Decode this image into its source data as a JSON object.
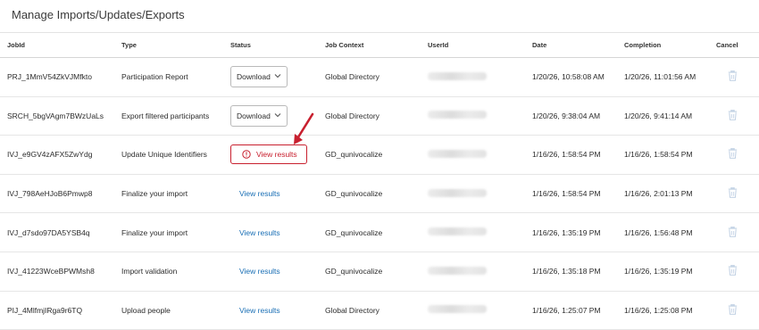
{
  "page": {
    "title": "Manage Imports/Updates/Exports"
  },
  "columns": {
    "jobid": "JobId",
    "type": "Type",
    "status": "Status",
    "context": "Job Context",
    "userid": "UserId",
    "date": "Date",
    "completion": "Completion",
    "cancel": "Cancel"
  },
  "colors": {
    "highlight": "#c8202f",
    "link": "#1a6fb5"
  },
  "rows": [
    {
      "jobid": "PRJ_1MmV54ZkVJMfkto",
      "type": "Participation Report",
      "status": "Download",
      "status_kind": "download",
      "context": "Global Directory",
      "date": "1/20/26, 10:58:08 AM",
      "completion": "1/20/26, 11:01:56 AM"
    },
    {
      "jobid": "SRCH_5bgVAgm7BWzUaLs",
      "type": "Export filtered participants",
      "status": "Download",
      "status_kind": "download",
      "context": "Global Directory",
      "date": "1/20/26, 9:38:04 AM",
      "completion": "1/20/26, 9:41:14 AM"
    },
    {
      "jobid": "IVJ_e9GV4zAFX5ZwYdg",
      "type": "Update Unique Identifiers",
      "status": "View results",
      "status_kind": "highlighted",
      "context": "GD_qunivocalize",
      "date": "1/16/26, 1:58:54 PM",
      "completion": "1/16/26, 1:58:54 PM"
    },
    {
      "jobid": "IVJ_798AeHJoB6Pmwp8",
      "type": "Finalize your import",
      "status": "View results",
      "status_kind": "link",
      "context": "GD_qunivocalize",
      "date": "1/16/26, 1:58:54 PM",
      "completion": "1/16/26, 2:01:13 PM"
    },
    {
      "jobid": "IVJ_d7sdo97DA5YSB4q",
      "type": "Finalize your import",
      "status": "View results",
      "status_kind": "link",
      "context": "GD_qunivocalize",
      "date": "1/16/26, 1:35:19 PM",
      "completion": "1/16/26, 1:56:48 PM"
    },
    {
      "jobid": "IVJ_41223WceBPWMsh8",
      "type": "Import validation",
      "status": "View results",
      "status_kind": "link",
      "context": "GD_qunivocalize",
      "date": "1/16/26, 1:35:18 PM",
      "completion": "1/16/26, 1:35:19 PM"
    },
    {
      "jobid": "PIJ_4MlfmjIRga9r6TQ",
      "type": "Upload people",
      "status": "View results",
      "status_kind": "link",
      "context": "Global Directory",
      "date": "1/16/26, 1:25:07 PM",
      "completion": "1/16/26, 1:25:08 PM"
    }
  ]
}
